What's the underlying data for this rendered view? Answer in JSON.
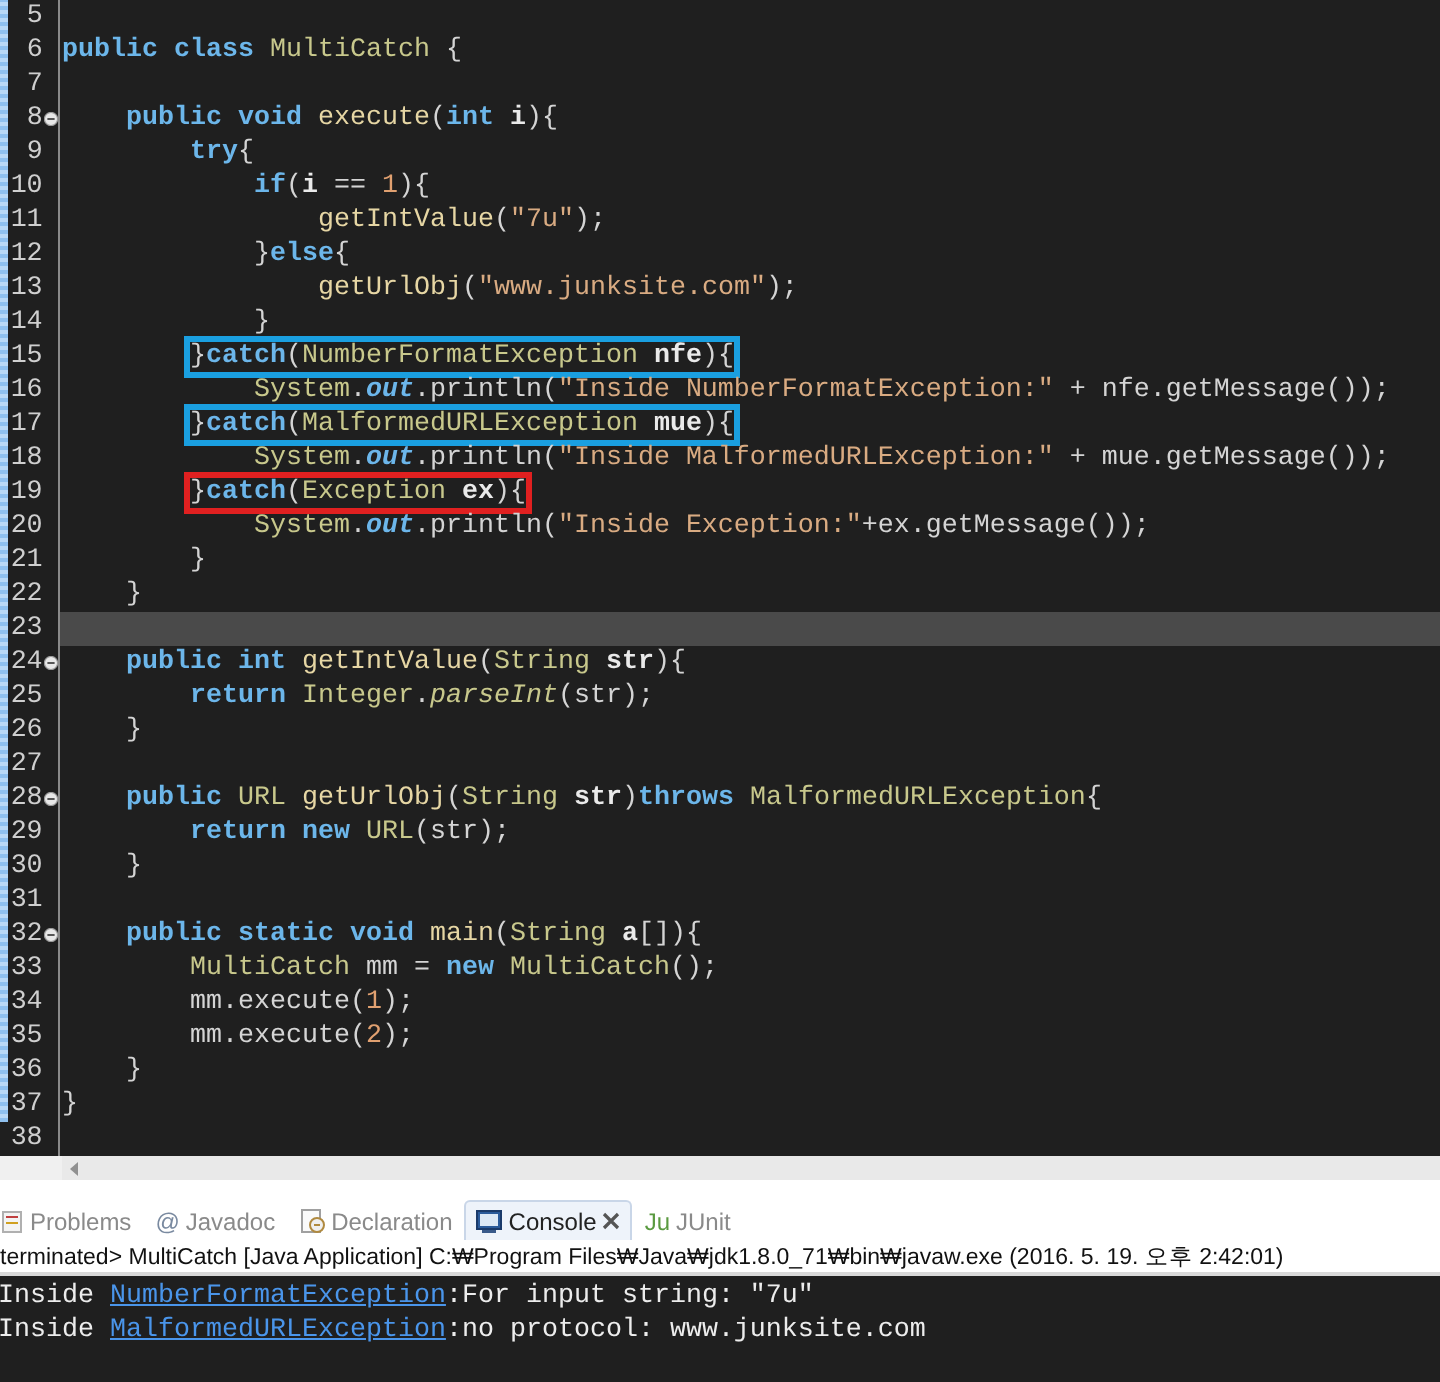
{
  "editor": {
    "lines": [
      {
        "n": "5",
        "fold": false,
        "current": false
      },
      {
        "n": "6",
        "fold": false,
        "current": false,
        "tokens": [
          {
            "kind": "kw",
            "text": "public"
          },
          {
            "kind": "kw",
            "text": " class"
          },
          {
            "kind": "type",
            "text": " MultiCatch"
          },
          {
            "kind": "txt",
            "text": " {"
          }
        ]
      },
      {
        "n": "7",
        "fold": false,
        "current": false
      },
      {
        "n": "8",
        "fold": true,
        "current": false,
        "tokens": [
          {
            "kind": "kw",
            "text": "    public"
          },
          {
            "kind": "kw",
            "text": " void"
          },
          {
            "kind": "fn",
            "text": " execute"
          },
          {
            "kind": "txt",
            "text": "("
          },
          {
            "kind": "kw",
            "text": "int"
          },
          {
            "kind": "var",
            "text": " i"
          },
          {
            "kind": "txt",
            "text": "){"
          }
        ]
      },
      {
        "n": "9",
        "fold": false,
        "current": false,
        "tokens": [
          {
            "kind": "kw",
            "text": "        try"
          },
          {
            "kind": "txt",
            "text": "{"
          }
        ]
      },
      {
        "n": "10",
        "fold": false,
        "current": false,
        "tokens": [
          {
            "kind": "kw",
            "text": "            if"
          },
          {
            "kind": "txt",
            "text": "("
          },
          {
            "kind": "var",
            "text": "i"
          },
          {
            "kind": "txt",
            "text": " == "
          },
          {
            "kind": "num",
            "text": "1"
          },
          {
            "kind": "txt",
            "text": "){"
          }
        ]
      },
      {
        "n": "11",
        "fold": false,
        "current": false,
        "tokens": [
          {
            "kind": "fn",
            "text": "                getIntValue"
          },
          {
            "kind": "txt",
            "text": "("
          },
          {
            "kind": "str",
            "text": "\"7u\""
          },
          {
            "kind": "txt",
            "text": ");"
          }
        ]
      },
      {
        "n": "12",
        "fold": false,
        "current": false,
        "tokens": [
          {
            "kind": "txt",
            "text": "            }"
          },
          {
            "kind": "kw",
            "text": "else"
          },
          {
            "kind": "txt",
            "text": "{"
          }
        ]
      },
      {
        "n": "13",
        "fold": false,
        "current": false,
        "tokens": [
          {
            "kind": "fn",
            "text": "                getUrlObj"
          },
          {
            "kind": "txt",
            "text": "("
          },
          {
            "kind": "str",
            "text": "\"www.junksite.com\""
          },
          {
            "kind": "txt",
            "text": ");"
          }
        ]
      },
      {
        "n": "14",
        "fold": false,
        "current": false,
        "tokens": [
          {
            "kind": "txt",
            "text": "            }"
          }
        ]
      },
      {
        "n": "15",
        "fold": false,
        "current": false,
        "color": "#1a9fe0",
        "tokens": [
          {
            "kind": "txt",
            "text": "        }"
          },
          {
            "kind": "kw",
            "text": "catch"
          },
          {
            "kind": "txt",
            "text": "("
          },
          {
            "kind": "type",
            "text": "NumberFormatException"
          },
          {
            "kind": "var",
            "text": " nfe"
          },
          {
            "kind": "txt",
            "text": "){"
          }
        ]
      },
      {
        "n": "16",
        "fold": false,
        "current": false,
        "tokens": [
          {
            "kind": "type",
            "text": "            System"
          },
          {
            "kind": "txt",
            "text": "."
          },
          {
            "kind": "field",
            "text": "out"
          },
          {
            "kind": "txt",
            "text": ".println("
          },
          {
            "kind": "str",
            "text": "\"Inside NumberFormatException:\""
          },
          {
            "kind": "txt",
            "text": " + nfe.getMessage());"
          }
        ]
      },
      {
        "n": "17",
        "fold": false,
        "current": false,
        "color": "#1a9fe0",
        "tokens": [
          {
            "kind": "txt",
            "text": "        }"
          },
          {
            "kind": "kw",
            "text": "catch"
          },
          {
            "kind": "txt",
            "text": "("
          },
          {
            "kind": "type",
            "text": "MalformedURLException"
          },
          {
            "kind": "var",
            "text": " mue"
          },
          {
            "kind": "txt",
            "text": "){"
          }
        ]
      },
      {
        "n": "18",
        "fold": false,
        "current": false,
        "tokens": [
          {
            "kind": "type",
            "text": "            System"
          },
          {
            "kind": "txt",
            "text": "."
          },
          {
            "kind": "field",
            "text": "out"
          },
          {
            "kind": "txt",
            "text": ".println("
          },
          {
            "kind": "str",
            "text": "\"Inside MalformedURLException:\""
          },
          {
            "kind": "txt",
            "text": " + mue.getMessage());"
          }
        ]
      },
      {
        "n": "19",
        "fold": false,
        "current": false,
        "color": "#e02020",
        "tokens": [
          {
            "kind": "txt",
            "text": "        }"
          },
          {
            "kind": "kw",
            "text": "catch"
          },
          {
            "kind": "txt",
            "text": "("
          },
          {
            "kind": "type",
            "text": "Exception"
          },
          {
            "kind": "var",
            "text": " ex"
          },
          {
            "kind": "txt",
            "text": "){"
          }
        ]
      },
      {
        "n": "20",
        "fold": false,
        "current": false,
        "tokens": [
          {
            "kind": "type",
            "text": "            System"
          },
          {
            "kind": "txt",
            "text": "."
          },
          {
            "kind": "field",
            "text": "out"
          },
          {
            "kind": "txt",
            "text": ".println("
          },
          {
            "kind": "str",
            "text": "\"Inside Exception:\""
          },
          {
            "kind": "txt",
            "text": "+ex.getMessage());"
          }
        ]
      },
      {
        "n": "21",
        "fold": false,
        "current": false,
        "tokens": [
          {
            "kind": "txt",
            "text": "        }"
          }
        ]
      },
      {
        "n": "22",
        "fold": false,
        "current": false,
        "tokens": [
          {
            "kind": "txt",
            "text": "    }"
          }
        ]
      },
      {
        "n": "23",
        "fold": false,
        "current": true
      },
      {
        "n": "24",
        "fold": true,
        "current": false,
        "tokens": [
          {
            "kind": "kw",
            "text": "    public"
          },
          {
            "kind": "kw",
            "text": " int"
          },
          {
            "kind": "fn",
            "text": " getIntValue"
          },
          {
            "kind": "txt",
            "text": "("
          },
          {
            "kind": "type",
            "text": "String"
          },
          {
            "kind": "var",
            "text": " str"
          },
          {
            "kind": "txt",
            "text": "){"
          }
        ]
      },
      {
        "n": "25",
        "fold": false,
        "current": false,
        "tokens": [
          {
            "kind": "kw",
            "text": "        return"
          },
          {
            "kind": "type",
            "text": " Integer"
          },
          {
            "kind": "txt",
            "text": "."
          },
          {
            "kind": "smeth",
            "text": "parseInt"
          },
          {
            "kind": "txt",
            "text": "(str);"
          }
        ]
      },
      {
        "n": "26",
        "fold": false,
        "current": false,
        "tokens": [
          {
            "kind": "txt",
            "text": "    }"
          }
        ]
      },
      {
        "n": "27",
        "fold": false,
        "current": false
      },
      {
        "n": "28",
        "fold": true,
        "current": false,
        "tokens": [
          {
            "kind": "kw",
            "text": "    public"
          },
          {
            "kind": "type",
            "text": " URL"
          },
          {
            "kind": "fn",
            "text": " getUrlObj"
          },
          {
            "kind": "txt",
            "text": "("
          },
          {
            "kind": "type",
            "text": "String"
          },
          {
            "kind": "var",
            "text": " str"
          },
          {
            "kind": "txt",
            "text": ")"
          },
          {
            "kind": "kw",
            "text": "throws"
          },
          {
            "kind": "type",
            "text": " MalformedURLException"
          },
          {
            "kind": "txt",
            "text": "{"
          }
        ]
      },
      {
        "n": "29",
        "fold": false,
        "current": false,
        "tokens": [
          {
            "kind": "kw",
            "text": "        return"
          },
          {
            "kind": "kw",
            "text": " new"
          },
          {
            "kind": "type",
            "text": " URL"
          },
          {
            "kind": "txt",
            "text": "(str);"
          }
        ]
      },
      {
        "n": "30",
        "fold": false,
        "current": false,
        "tokens": [
          {
            "kind": "txt",
            "text": "    }"
          }
        ]
      },
      {
        "n": "31",
        "fold": false,
        "current": false
      },
      {
        "n": "32",
        "fold": true,
        "current": false,
        "tokens": [
          {
            "kind": "kw",
            "text": "    public"
          },
          {
            "kind": "kw",
            "text": " static"
          },
          {
            "kind": "kw",
            "text": " void"
          },
          {
            "kind": "fn",
            "text": " main"
          },
          {
            "kind": "txt",
            "text": "("
          },
          {
            "kind": "type",
            "text": "String"
          },
          {
            "kind": "var",
            "text": " a"
          },
          {
            "kind": "txt",
            "text": "[]){"
          }
        ]
      },
      {
        "n": "33",
        "fold": false,
        "current": false,
        "tokens": [
          {
            "kind": "type",
            "text": "        MultiCatch"
          },
          {
            "kind": "txt",
            "text": " mm = "
          },
          {
            "kind": "kw",
            "text": "new"
          },
          {
            "kind": "type",
            "text": " MultiCatch"
          },
          {
            "kind": "txt",
            "text": "();"
          }
        ]
      },
      {
        "n": "34",
        "fold": false,
        "current": false,
        "tokens": [
          {
            "kind": "txt",
            "text": "        mm.execute("
          },
          {
            "kind": "num",
            "text": "1"
          },
          {
            "kind": "txt",
            "text": ");"
          }
        ]
      },
      {
        "n": "35",
        "fold": false,
        "current": false,
        "tokens": [
          {
            "kind": "txt",
            "text": "        mm.execute("
          },
          {
            "kind": "num",
            "text": "2"
          },
          {
            "kind": "txt",
            "text": ");"
          }
        ]
      },
      {
        "n": "36",
        "fold": false,
        "current": false,
        "tokens": [
          {
            "kind": "txt",
            "text": "    }"
          }
        ]
      },
      {
        "n": "37",
        "fold": false,
        "current": false,
        "tokens": [
          {
            "kind": "txt",
            "text": "}"
          }
        ]
      },
      {
        "n": "38",
        "fold": false,
        "current": false
      }
    ]
  },
  "views": [
    {
      "label": "Problems",
      "kind": "problems",
      "selected": false,
      "closable": false
    },
    {
      "label": "Javadoc",
      "kind": "text",
      "icon_text": "@",
      "selected": false,
      "closable": false
    },
    {
      "label": "Declaration",
      "kind": "declaration",
      "selected": false,
      "closable": false
    },
    {
      "label": "Console",
      "kind": "console",
      "selected": true,
      "closable": true
    },
    {
      "label": "JUnit",
      "kind": "text",
      "icon_text": "Ju",
      "selected": false,
      "closable": false
    }
  ],
  "console": {
    "status": "terminated> MultiCatch [Java Application] C:₩Program Files₩Java₩jdk1.8.0_71₩bin₩javaw.exe (2016. 5. 19. 오후 2:42:01)",
    "lines": [
      {
        "parts": [
          {
            "kind": "text",
            "text": "Inside "
          },
          {
            "kind": "link",
            "text": "NumberFormatException"
          },
          {
            "kind": "text",
            "text": ":For input string: \"7u\""
          }
        ]
      },
      {
        "parts": [
          {
            "kind": "text",
            "text": "Inside "
          },
          {
            "kind": "link",
            "text": "MalformedURLException"
          },
          {
            "kind": "text",
            "text": ":no protocol: www.junksite.com"
          }
        ]
      }
    ]
  }
}
